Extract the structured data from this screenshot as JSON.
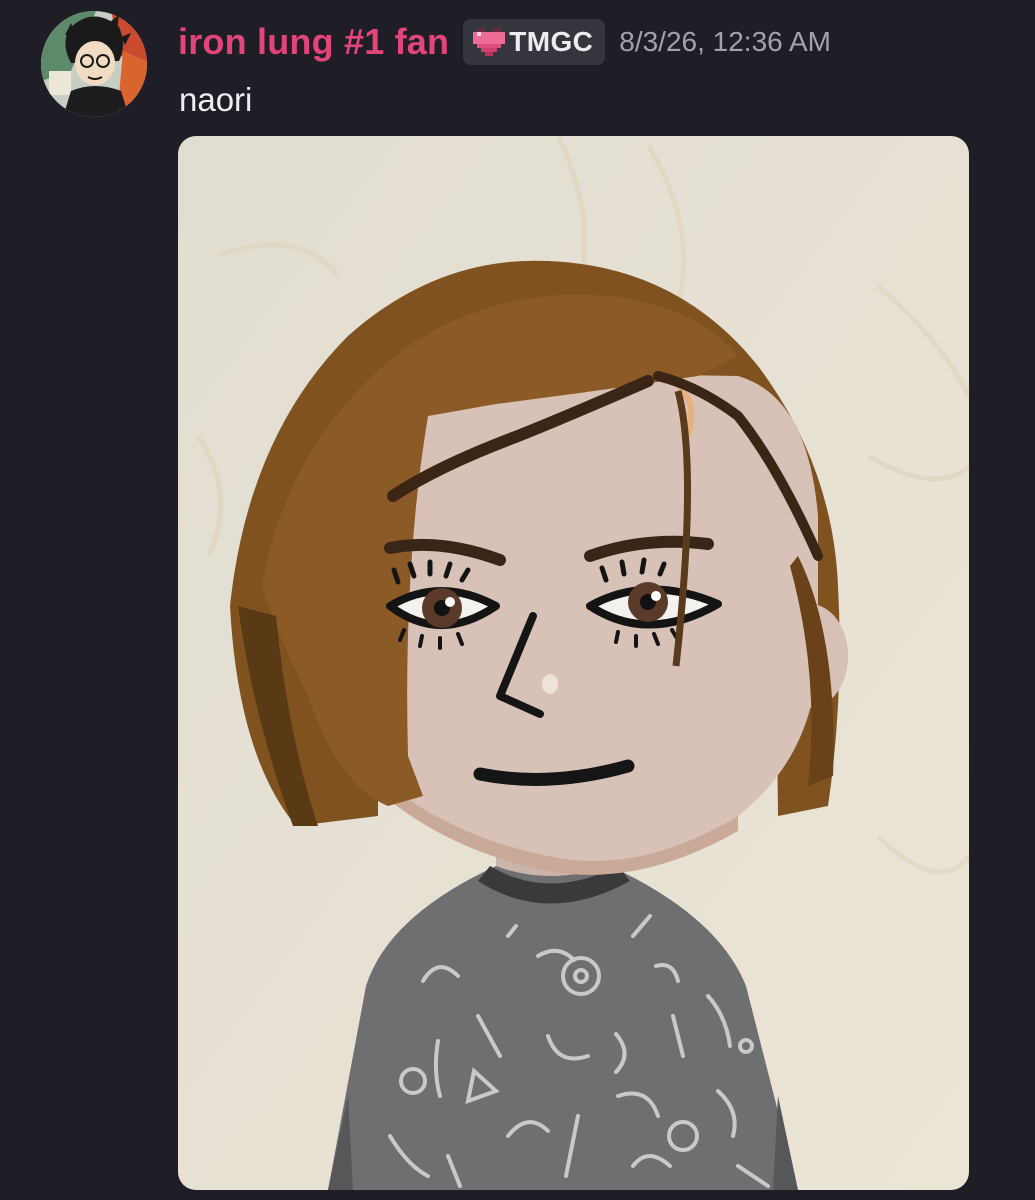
{
  "message": {
    "author": {
      "display_name": "iron lung #1 fan",
      "name_color": "#e4447c",
      "avatar_icon": "user-avatar"
    },
    "guild_tag": {
      "icon": "pink-heart-icon",
      "label": "TMGC"
    },
    "timestamp": "8/3/26, 12:36 AM",
    "text": "naori",
    "attachment": {
      "type": "image",
      "subject": "mii-character-portrait"
    }
  }
}
